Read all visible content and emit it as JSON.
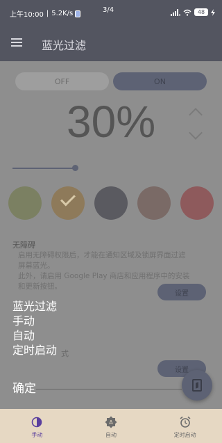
{
  "status_bar": {
    "time": "上午10:00",
    "separator": "|",
    "network_speed": "5.2K/s",
    "page_indicator": "3/4",
    "battery": "48"
  },
  "app_bar": {
    "title": "蓝光过滤"
  },
  "toggle": {
    "off_label": "OFF",
    "on_label": "ON",
    "selected": "ON"
  },
  "filter": {
    "percent_label": "30%",
    "intensity": 0.3
  },
  "swatch_colors": [
    "#7b8062",
    "#8e7a5a",
    "#5a5a60",
    "#7a6a66",
    "#8e5a5c"
  ],
  "selected_swatch": 1,
  "accessibility": {
    "title": "无障碍",
    "desc_line1": "启用无障碍权限后，才能在通知区域及锁屏界面过滤",
    "desc_line2": "屏幕蓝光。",
    "desc_line3": "此外，请启用 Google Play 商店和应用程序中的安装",
    "desc_line4": "和更新按钮。",
    "set_button": "设置"
  },
  "mode_section": {
    "partial_label": "式",
    "set_button": "设置"
  },
  "overlay_menu": {
    "items": [
      "蓝光过滤",
      "手动",
      "自动",
      "定时启动"
    ],
    "confirm": "确定"
  },
  "bottom_nav": {
    "items": [
      {
        "label": "手动",
        "icon": "contrast-icon"
      },
      {
        "label": "自动",
        "icon": "auto-brightness-icon"
      },
      {
        "label": "定时启动",
        "icon": "alarm-clock-icon"
      }
    ]
  },
  "colors": {
    "accent": "#5a3f9e",
    "bar_bg": "#535560",
    "nav_bg": "#e6d8c3"
  }
}
